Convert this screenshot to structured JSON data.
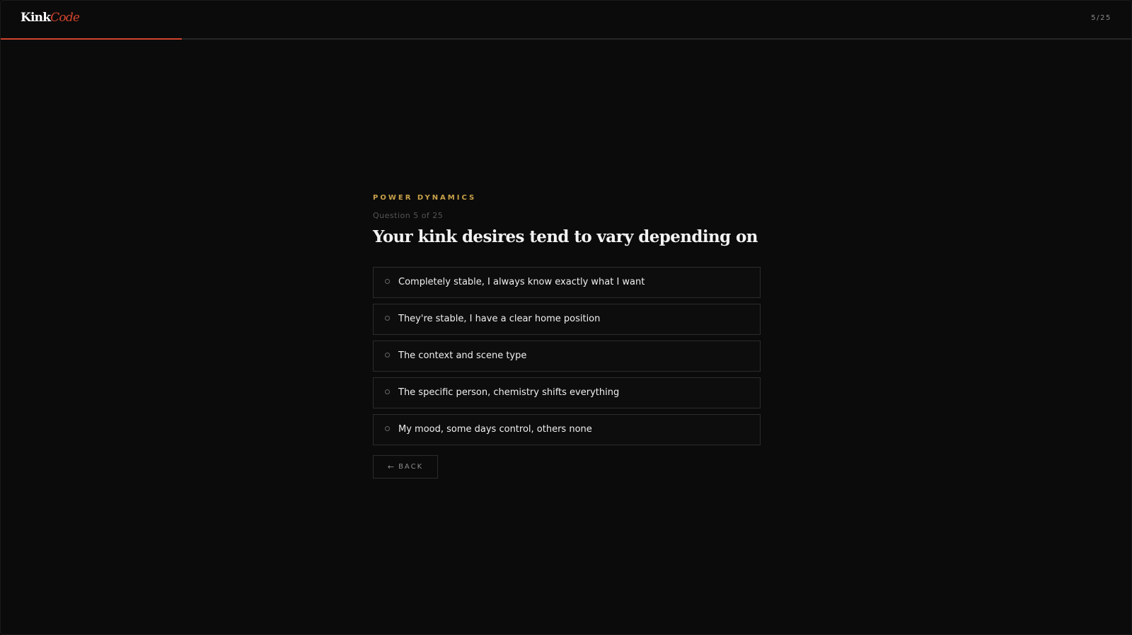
{
  "header": {
    "logo_primary": "Kink",
    "logo_accent": "Code",
    "counter": "5/25",
    "progress_fraction": 0.16,
    "accent_color": "#d0442f"
  },
  "quiz": {
    "category": "POWER DYNAMICS",
    "question_number": "Question 5 of 25",
    "question": "Your kink desires tend to vary depending on",
    "options": [
      {
        "label": "Completely stable, I always know exactly what I want"
      },
      {
        "label": "They're stable, I have a clear home position"
      },
      {
        "label": "The context and scene type"
      },
      {
        "label": "The specific person, chemistry shifts everything"
      },
      {
        "label": "My mood, some days control, others none"
      }
    ],
    "back_arrow": "←",
    "back_label": "BACK",
    "category_color": "#c9a24a"
  }
}
